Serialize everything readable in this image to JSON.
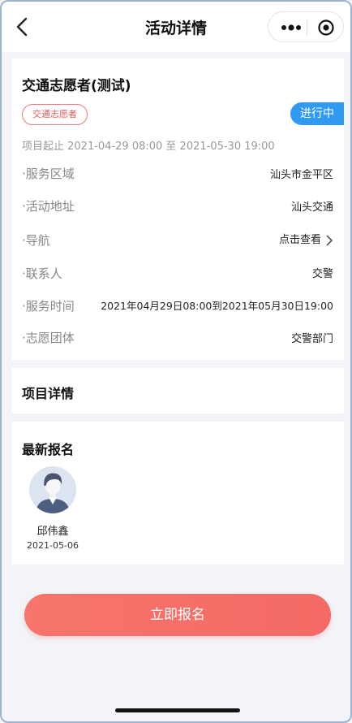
{
  "header": {
    "title": "活动详情"
  },
  "event": {
    "title": "交通志愿者(测试)",
    "tag": "交通志愿者",
    "status": "进行中",
    "period": "项目起止 2021-04-29 08:00 至 2021-05-30 19:00",
    "rows": [
      {
        "label": "·服务区域",
        "value": "汕头市金平区"
      },
      {
        "label": "·活动地址",
        "value": "汕头交通"
      },
      {
        "label": "·导航",
        "value": "点击查看"
      },
      {
        "label": "·联系人",
        "value": "交警"
      },
      {
        "label": "·服务时间",
        "value": "2021年04月29日08:00到2021年05月30日19:00"
      },
      {
        "label": "·志愿团体",
        "value": "交警部门"
      }
    ]
  },
  "details": {
    "title": "项目详情"
  },
  "signups": {
    "title": "最新报名",
    "users": [
      {
        "name": "邱伟鑫",
        "date": "2021-05-06"
      }
    ]
  },
  "actions": {
    "signup_label": "立即报名"
  },
  "colors": {
    "accent_blue": "#2f9af0",
    "tag_red": "#e45a5a",
    "button_red": "#f46a66",
    "background": "#f2f4f8"
  },
  "icons": {
    "back": "back-arrow-icon",
    "more": "more-dots-icon",
    "close": "target-close-icon",
    "chevron": "chevron-right-icon",
    "avatar": "user-avatar-icon"
  }
}
